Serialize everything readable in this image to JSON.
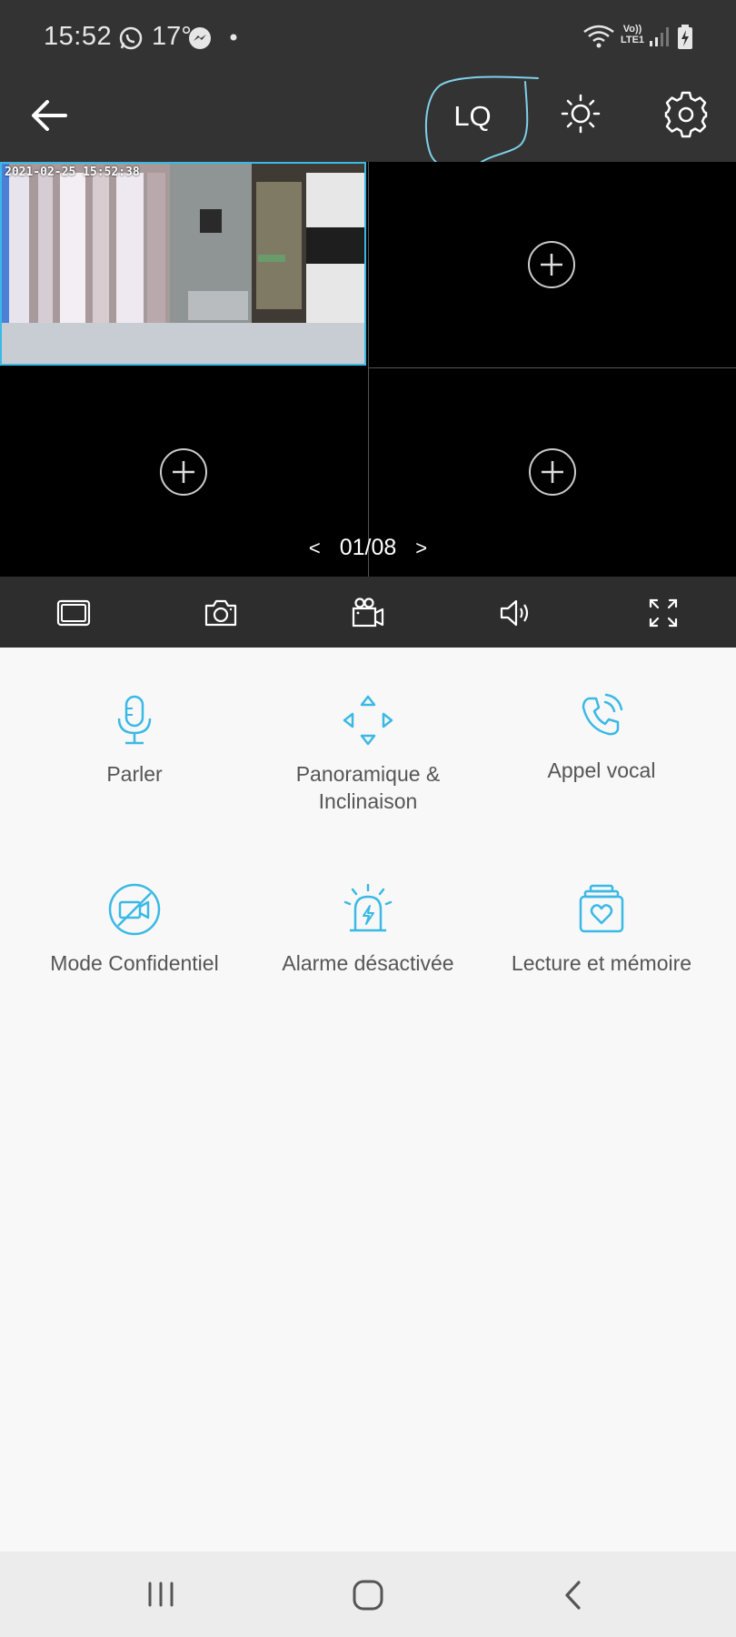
{
  "status_bar": {
    "time": "15:52",
    "temperature": "17°",
    "network_label": "Vo)) LTE1"
  },
  "app_bar": {
    "quality_label": "LQ"
  },
  "camera": {
    "timestamp": "2021-02-25  15:52:38",
    "page_indicator": "01/08",
    "prev_label": "<",
    "next_label": ">"
  },
  "features": [
    {
      "label": "Parler",
      "icon": "microphone-icon"
    },
    {
      "label": "Panoramique & Inclinaison",
      "icon": "pan-tilt-icon"
    },
    {
      "label": "Appel vocal",
      "icon": "phone-call-icon"
    },
    {
      "label": "Mode Confidentiel",
      "icon": "privacy-camera-off-icon"
    },
    {
      "label": "Alarme désactivée",
      "icon": "alarm-siren-icon"
    },
    {
      "label": "Lecture et mémoire",
      "icon": "playback-memory-icon"
    }
  ],
  "colors": {
    "accent": "#3ab9e6",
    "dark_bar": "#333333",
    "background": "#f8f8f8"
  }
}
